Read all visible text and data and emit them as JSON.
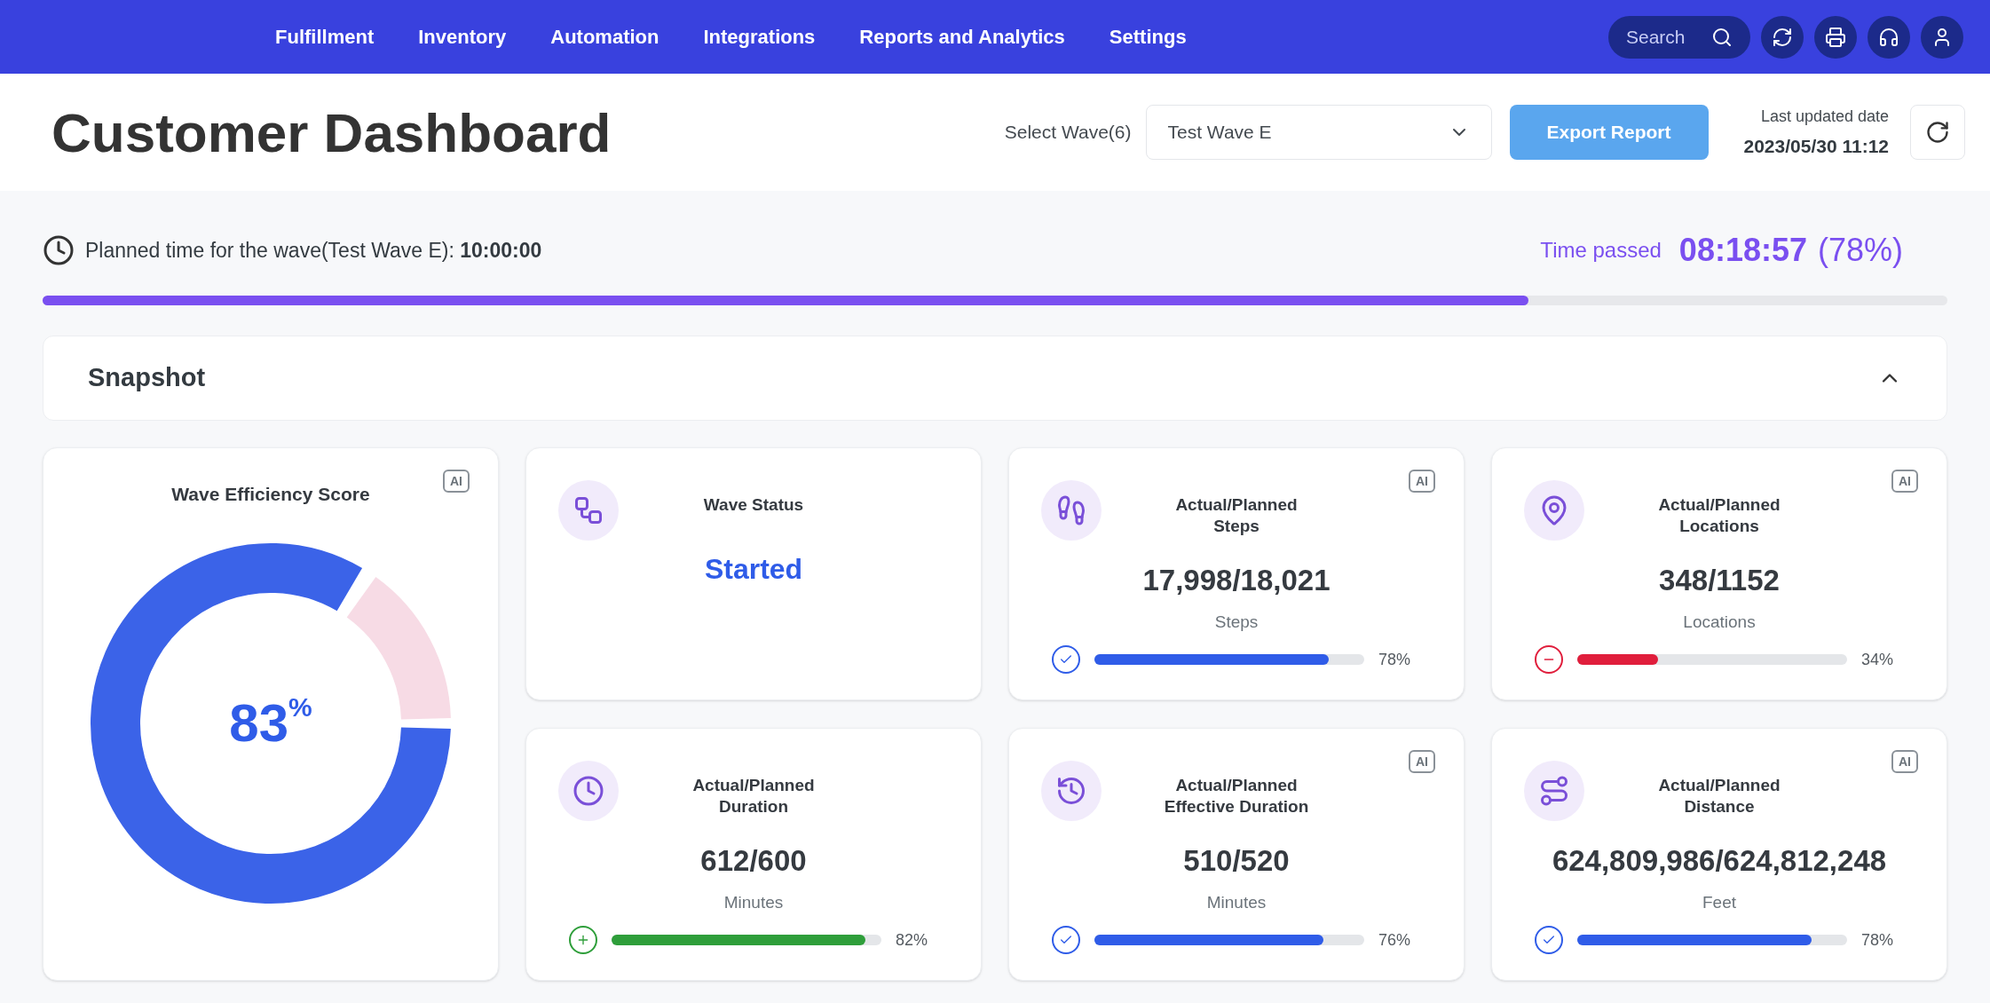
{
  "nav": {
    "items": [
      {
        "label": "Fulfillment"
      },
      {
        "label": "Inventory"
      },
      {
        "label": "Automation"
      },
      {
        "label": "Integrations"
      },
      {
        "label": "Reports and Analytics"
      },
      {
        "label": "Settings"
      }
    ],
    "search": {
      "placeholder": "Search"
    }
  },
  "header": {
    "title": "Customer Dashboard",
    "wave_label": "Select Wave(6)",
    "wave_value": "Test Wave E",
    "export_button": "Export Report",
    "updated_label": "Last updated date",
    "updated_value": "2023/05/30 11:12"
  },
  "timeline": {
    "planned_label": "Planned time for the wave(Test Wave E): ",
    "planned_value": "10:00:00",
    "passed_label": "Time passed",
    "passed_value": "08:18:57",
    "passed_percent": "(78%)",
    "level": 0.78
  },
  "snapshot": {
    "title": "Snapshot",
    "expanded": true
  },
  "score_card": {
    "title": "Wave Efficiency Score",
    "badge": "AI",
    "value": "83",
    "unit": "%",
    "level": 0.83
  },
  "cards": [
    {
      "title": "Wave Status",
      "status": "Started",
      "kind": "status"
    },
    {
      "title": "Actual/Planned\nSteps",
      "badge": "AI",
      "value": "17,998/18,021",
      "unit": "Steps",
      "kind": "check",
      "color": "#2f5ce8",
      "level": 0.87,
      "percent": "78%"
    },
    {
      "title": "Actual/Planned\nLocations",
      "badge": "AI",
      "value": "348/1152",
      "unit": "Locations",
      "kind": "minus",
      "color": "#e01e3c",
      "level": 0.3,
      "percent": "34%"
    },
    {
      "title": "Actual/Planned\nDuration",
      "value": "612/600",
      "unit": "Minutes",
      "kind": "plus",
      "color": "#2e9e3a",
      "level": 0.94,
      "percent": "82%"
    },
    {
      "title": "Actual/Planned\nEffective Duration",
      "badge": "AI",
      "value": "510/520",
      "unit": "Minutes",
      "kind": "check",
      "color": "#2f5ce8",
      "level": 0.85,
      "percent": "76%"
    },
    {
      "title": "Actual/Planned\nDistance",
      "badge": "AI",
      "value": "624,809,986/624,812,248",
      "unit": "Feet",
      "kind": "check",
      "color": "#2f5ce8",
      "level": 0.87,
      "percent": "78%"
    }
  ]
}
